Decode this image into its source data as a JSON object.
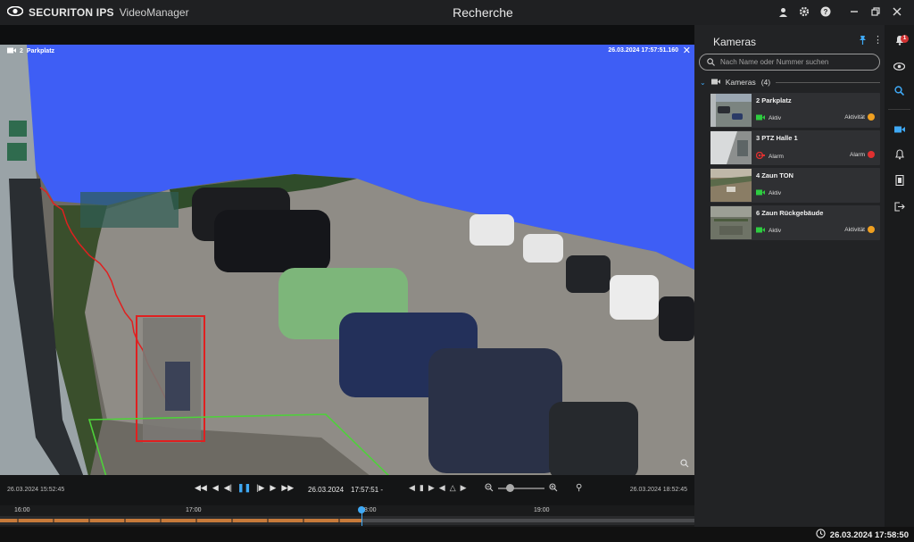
{
  "app": {
    "brand": "SECURITON IPS",
    "product": "VideoManager",
    "window_title": "Recherche"
  },
  "titlebar_icons": [
    "user-icon",
    "gear-icon",
    "help-icon",
    "minimize-icon",
    "restore-icon",
    "close-icon"
  ],
  "video": {
    "camera_number": "2",
    "camera_name": "Parkplatz",
    "timestamp": "26.03.2024 17:57:51.160",
    "close_glyph": "✕"
  },
  "controls": {
    "range_start": "26.03.2024 15:52:45",
    "range_end": "26.03.2024 18:52:45",
    "date": "26.03.2024",
    "time": "17:57:51 -",
    "zoom_level": 0.2
  },
  "timeline": {
    "labels": [
      "16:00",
      "17:00",
      "18:00",
      "19:00"
    ],
    "cursor_time": "17:57:51"
  },
  "panel": {
    "title": "Kameras",
    "search_placeholder": "Nach Name oder Nummer suchen",
    "group_label": "Kameras",
    "group_count": "(4)",
    "cameras": [
      {
        "label": "2  Parkplatz",
        "status": "Aktiv",
        "event": "Aktivität",
        "status_color": "#2ecc40",
        "event_color": "#f0a020"
      },
      {
        "label": "3  PTZ Halle 1",
        "status": "Alarm",
        "event": "Alarm",
        "status_color": "#e03030",
        "event_color": "#e03030"
      },
      {
        "label": "4  Zaun TON",
        "status": "Aktiv",
        "event": "",
        "status_color": "#2ecc40",
        "event_color": ""
      },
      {
        "label": "6  Zaun Rückgebäude",
        "status": "Aktiv",
        "event": "Aktivität",
        "status_color": "#2ecc40",
        "event_color": "#f0a020"
      }
    ]
  },
  "rail": {
    "notification_count": "1",
    "icons": [
      "bell-icon",
      "eye-icon",
      "search-icon",
      "camera-icon",
      "alarm-bell-icon",
      "film-icon",
      "logout-icon"
    ]
  },
  "status_bar": {
    "clock": "26.03.2024 17:58:50"
  },
  "colors": {
    "accent": "#3fa9f5",
    "sky": "#3e5ef5",
    "alarm": "#e03030",
    "active": "#2ecc40",
    "activity": "#f0a020"
  }
}
